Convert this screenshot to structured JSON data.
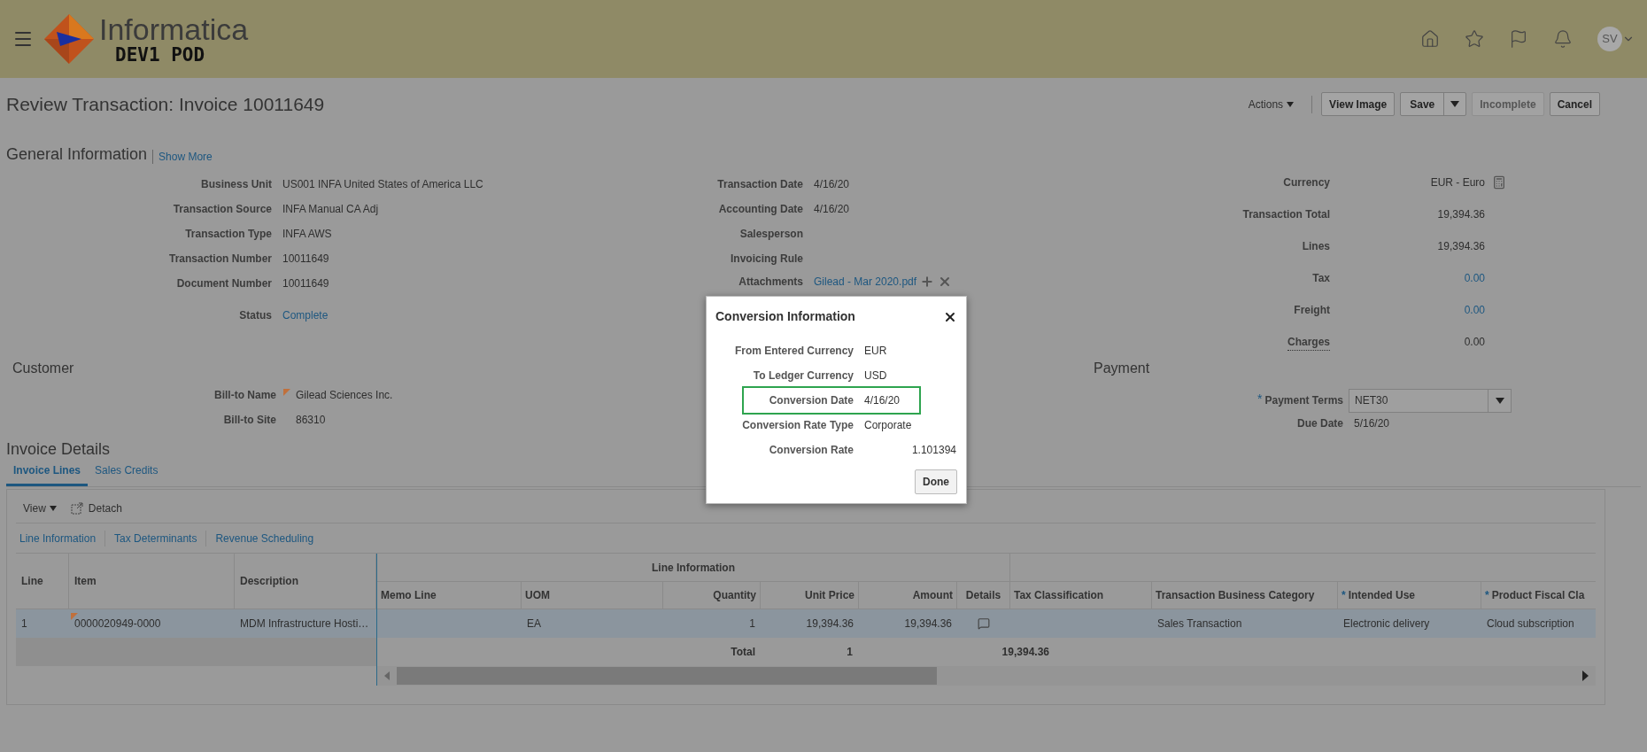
{
  "header": {
    "brand": "Informatica",
    "environment": "DEV1 POD",
    "avatar": "SV"
  },
  "page": {
    "title": "Review Transaction: Invoice 10011649",
    "actions_menu": "Actions",
    "buttons": [
      {
        "label": "View Image",
        "kind": "plain",
        "disabled": false
      },
      {
        "label": "Save",
        "kind": "split",
        "disabled": false
      },
      {
        "label": "Incomplete",
        "kind": "plain",
        "disabled": true
      },
      {
        "label": "Cancel",
        "kind": "plain",
        "disabled": false
      }
    ]
  },
  "general": {
    "title": "General Information",
    "show_more": "Show More",
    "column_1": [
      {
        "label": "Business Unit",
        "value": "US001 INFA United States of America LLC",
        "kind": "text"
      },
      {
        "label": "Transaction Source",
        "value": "INFA Manual CA Adj",
        "kind": "text"
      },
      {
        "label": "Transaction Type",
        "value": "INFA AWS",
        "kind": "text"
      },
      {
        "label": "Transaction Number",
        "value": "10011649",
        "kind": "text"
      },
      {
        "label": "Document Number",
        "value": "10011649",
        "kind": "text"
      },
      {
        "label": "Status",
        "value": "Complete",
        "kind": "link"
      }
    ],
    "column_2": [
      {
        "label": "Transaction Date",
        "value": "4/16/20",
        "kind": "text"
      },
      {
        "label": "Accounting Date",
        "value": "4/16/20",
        "kind": "text"
      },
      {
        "label": "Salesperson"
      },
      {
        "label": "Invoicing Rule"
      },
      {
        "label": "Attachments",
        "value": "Gilead - Mar 2020.pdf",
        "kind": "attachment"
      }
    ],
    "column_3": [
      {
        "label": "Currency",
        "value": "EUR - Euro",
        "kind": "currency"
      },
      {
        "label": "Transaction Total",
        "value": "19,394.36",
        "kind": "text"
      },
      {
        "label": "Lines",
        "value": "19,394.36",
        "kind": "text"
      },
      {
        "label": "Tax",
        "value": "0.00",
        "kind": "link"
      },
      {
        "label": "Freight",
        "value": "0.00",
        "kind": "link"
      },
      {
        "label": "Charges",
        "value": "0.00",
        "kind": "hint"
      }
    ]
  },
  "customer": {
    "title": "Customer",
    "fields": [
      {
        "label": "Bill-to Name",
        "value": "Gilead Sciences Inc.",
        "flagged": true
      },
      {
        "label": "Bill-to Site",
        "value": "86310",
        "flagged": false
      }
    ]
  },
  "payment": {
    "title": "Payment",
    "terms": {
      "label": "Payment Terms",
      "marker": "*",
      "value": "NET30"
    },
    "due": {
      "label": "Due Date",
      "value": "5/16/20"
    }
  },
  "invoice_details": {
    "title": "Invoice Details",
    "tabs": [
      {
        "label": "Invoice Lines",
        "selected": true
      },
      {
        "label": "Sales Credits",
        "selected": false
      }
    ],
    "toolbar": {
      "view": "View",
      "detach": "Detach"
    },
    "subtabs": [
      "Line Information",
      "Tax Determinants",
      "Revenue Scheduling"
    ],
    "table": {
      "group": "Line Information",
      "frozen_columns": [
        {
          "label": "Line"
        },
        {
          "label": "Item"
        },
        {
          "label": "Description"
        }
      ],
      "group_columns": [
        {
          "label": "Memo Line"
        },
        {
          "label": "UOM"
        },
        {
          "label": "Quantity"
        },
        {
          "label": "Unit Price"
        },
        {
          "label": "Amount"
        },
        {
          "label": "Details"
        }
      ],
      "other_columns": [
        {
          "label": "Tax Classification"
        },
        {
          "label": "Transaction Business Category"
        },
        {
          "label": "Intended Use",
          "marker": "*"
        },
        {
          "label": "Product Fiscal Cla",
          "marker": "*"
        }
      ],
      "rows": [
        {
          "selected": true,
          "item_flagged": true,
          "cells": [
            "1",
            "0000020949-0000",
            "MDM Infrastructure Hosti…",
            "",
            "EA",
            "1",
            "19,394.36",
            "19,394.36",
            "",
            "",
            "Sales Transaction",
            "Electronic delivery",
            "Cloud subscription"
          ]
        }
      ],
      "totals": {
        "label": "Total",
        "quantity": "1",
        "amount": "19,394.36"
      }
    }
  },
  "dialog": {
    "title": "Conversion Information",
    "fields": [
      {
        "label": "From Entered Currency",
        "value": "EUR",
        "highlighted": false
      },
      {
        "label": "To Ledger Currency",
        "value": "USD",
        "highlighted": false
      },
      {
        "label": "Conversion Date",
        "value": "4/16/20",
        "highlighted": true
      },
      {
        "label": "Conversion Rate Type",
        "value": "Corporate",
        "highlighted": false
      },
      {
        "label": "Conversion Rate",
        "value": "1.101394",
        "highlighted": false
      }
    ],
    "button": "Done"
  }
}
